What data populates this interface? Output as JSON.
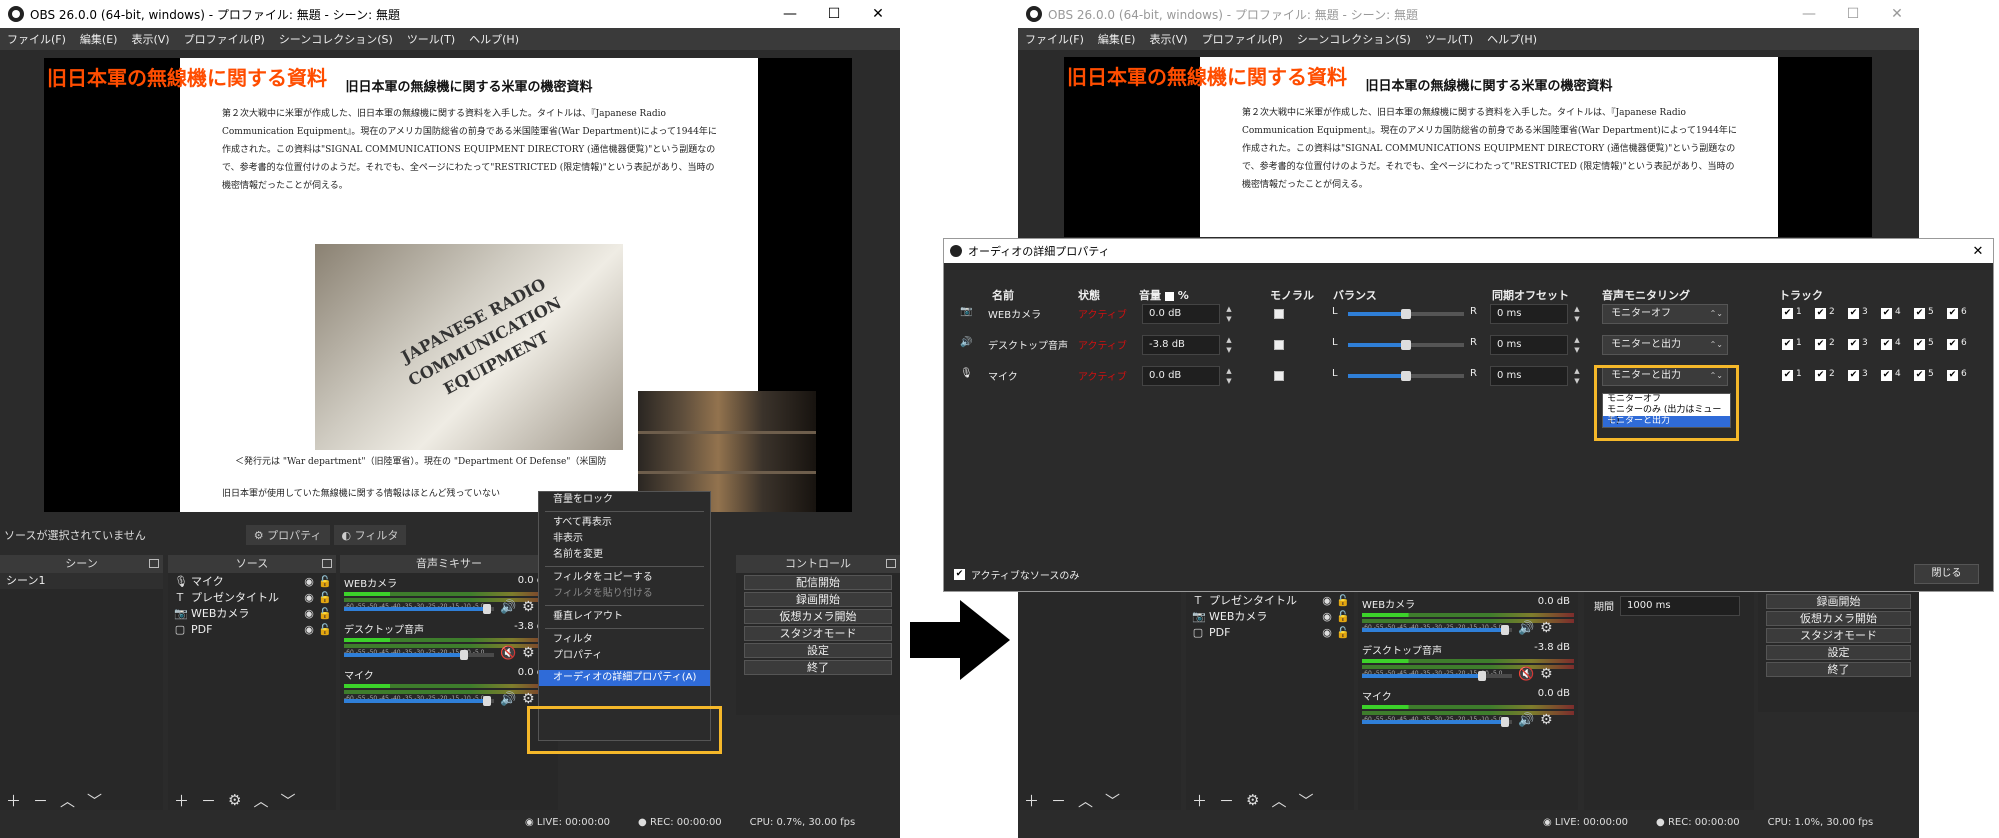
{
  "window": {
    "title": "OBS 26.0.0 (64-bit, windows) - プロファイル: 無題 - シーン: 無題",
    "controls": [
      "—",
      "☐",
      "✕"
    ]
  },
  "menu": [
    "ファイル(F)",
    "編集(E)",
    "表示(V)",
    "プロファイル(P)",
    "シーンコレクション(S)",
    "ツール(T)",
    "ヘルプ(H)"
  ],
  "preview": {
    "overlay_title": "旧日本軍の無線機に関する資料",
    "doc_title": "旧日本軍の無線機に関する米軍の機密資料",
    "doc_paragraph": "第２次大戦中に米軍が作成した、旧日本軍の無線機に関する資料を入手した。タイトルは、『Japanese Radio Communication Equipment』。現在のアメリカ国防総省の前身である米国陸軍省(War Department)によって1944年に作成された。この資料は\"SIGNAL COMMUNICATIONS EQUIPMENT DIRECTORY (通信機器便覧)\"という副題なので、参考書的な位置付けのようだ。それでも、全ページにわたって\"RESTRICTED (限定情報)\"という表記があり、当時の機密情報だったことが伺える。",
    "book_text": "JAPANESE RADIO\nCOMMUNICATION\nEQUIPMENT",
    "caption": "＜発行元は \"War department\"（旧陸軍省）。現在の \"Department Of Defense\"（米国防",
    "caption_right": "＜発行元は \"War department\"（旧陸軍省）。現在の \"Department Of Defense\"（米国防総省）",
    "tail_text": "旧日本軍が使用していた無線機に関する情報はほとんど残っていない"
  },
  "source_status": {
    "text": "ソースが選択されていません",
    "properties": "プロパティ",
    "filters": "フィルタ"
  },
  "docks": {
    "scenes": "シーン",
    "sources": "ソース",
    "mixer": "音声ミキサー",
    "controls": "コントロール"
  },
  "scenes": [
    "シーン1"
  ],
  "sources": [
    {
      "icon": "🎙",
      "name": "マイク"
    },
    {
      "icon": "T",
      "name": "プレゼンタイトル"
    },
    {
      "icon": "📷",
      "name": "WEBカメラ"
    },
    {
      "icon": "▢",
      "name": "PDF"
    }
  ],
  "sources_right": [
    {
      "icon": "T",
      "name": "プレゼンタイトル"
    },
    {
      "icon": "📷",
      "name": "WEBカメラ"
    },
    {
      "icon": "▢",
      "name": "PDF"
    }
  ],
  "mixer": [
    {
      "name": "WEBカメラ",
      "db": "0.0 dB",
      "vol": 0.95,
      "muted": false
    },
    {
      "name": "デスクトップ音声",
      "db": "-3.8 dB",
      "vol": 0.8,
      "muted": true
    },
    {
      "name": "マイク",
      "db": "0.0 dB",
      "vol": 0.95,
      "muted": false
    }
  ],
  "mixer_left_db": [
    "0.0",
    "-3.8",
    "0.0"
  ],
  "meter_scale": "-60 -55 -50 -45 -40 -35 -30 -25 -20 -15 -10 -5 0",
  "controls": [
    "配信開始",
    "録画開始",
    "仮想カメラ開始",
    "スタジオモード",
    "設定",
    "終了"
  ],
  "transition": {
    "label": "期間",
    "value": "1000 ms"
  },
  "context_menu": {
    "items": [
      {
        "label": "音量をロック",
        "disabled": false
      },
      {
        "sep": true
      },
      {
        "label": "すべて再表示",
        "disabled": false
      },
      {
        "label": "非表示",
        "disabled": false
      },
      {
        "label": "名前を変更",
        "disabled": false
      },
      {
        "sep": true
      },
      {
        "label": "フィルタをコピーする",
        "disabled": false
      },
      {
        "label": "フィルタを貼り付ける",
        "disabled": true
      },
      {
        "sep": true
      },
      {
        "label": "垂直レイアウト",
        "disabled": false
      },
      {
        "sep": true
      },
      {
        "label": "フィルタ",
        "disabled": false
      },
      {
        "label": "プロパティ",
        "disabled": false
      }
    ],
    "highlighted": "オーディオの詳細プロパティ(A)"
  },
  "statusbar": {
    "live": "LIVE: 00:00:00",
    "rec": "REC: 00:00:00",
    "cpu_left": "CPU: 0.7%, 30.00 fps",
    "cpu_right": "CPU: 1.0%, 30.00 fps"
  },
  "dialog": {
    "title": "オーディオの詳細プロパティ",
    "headers": {
      "name": "名前",
      "status": "状態",
      "volume": "音量",
      "percent": "%",
      "mono": "モノラル",
      "balance": "バランス",
      "sync": "同期オフセット",
      "monitoring": "音声モニタリング",
      "tracks": "トラック"
    },
    "rows": [
      {
        "icon": "📷",
        "name": "WEBカメラ",
        "status": "アクティブ",
        "volume": "0.0 dB",
        "sync": "0 ms",
        "monitor": "モニターオフ",
        "balance": 0.5
      },
      {
        "icon": "🔊",
        "name": "デスクトップ音声",
        "status": "アクティブ",
        "volume": "-3.8 dB",
        "sync": "0 ms",
        "monitor": "モニターと出力",
        "balance": 0.5
      },
      {
        "icon": "🎙",
        "name": "マイク",
        "status": "アクティブ",
        "volume": "0.0 dB",
        "sync": "0 ms",
        "monitor": "モニターと出力",
        "balance": 0.5
      }
    ],
    "balance_left": "L",
    "balance_right": "R",
    "tracks": [
      "1",
      "2",
      "3",
      "4",
      "5",
      "6"
    ],
    "dropdown_options": [
      "モニターオフ",
      "モニターのみ (出力はミュート)",
      "モニターと出力"
    ],
    "dropdown_selected": "モニターと出力",
    "active_only": "アクティブなソースのみ",
    "close": "閉じる"
  },
  "colors": {
    "highlight": "#f5b82a",
    "status_active": "#d01010",
    "overlay_title": "#ff4d00"
  }
}
